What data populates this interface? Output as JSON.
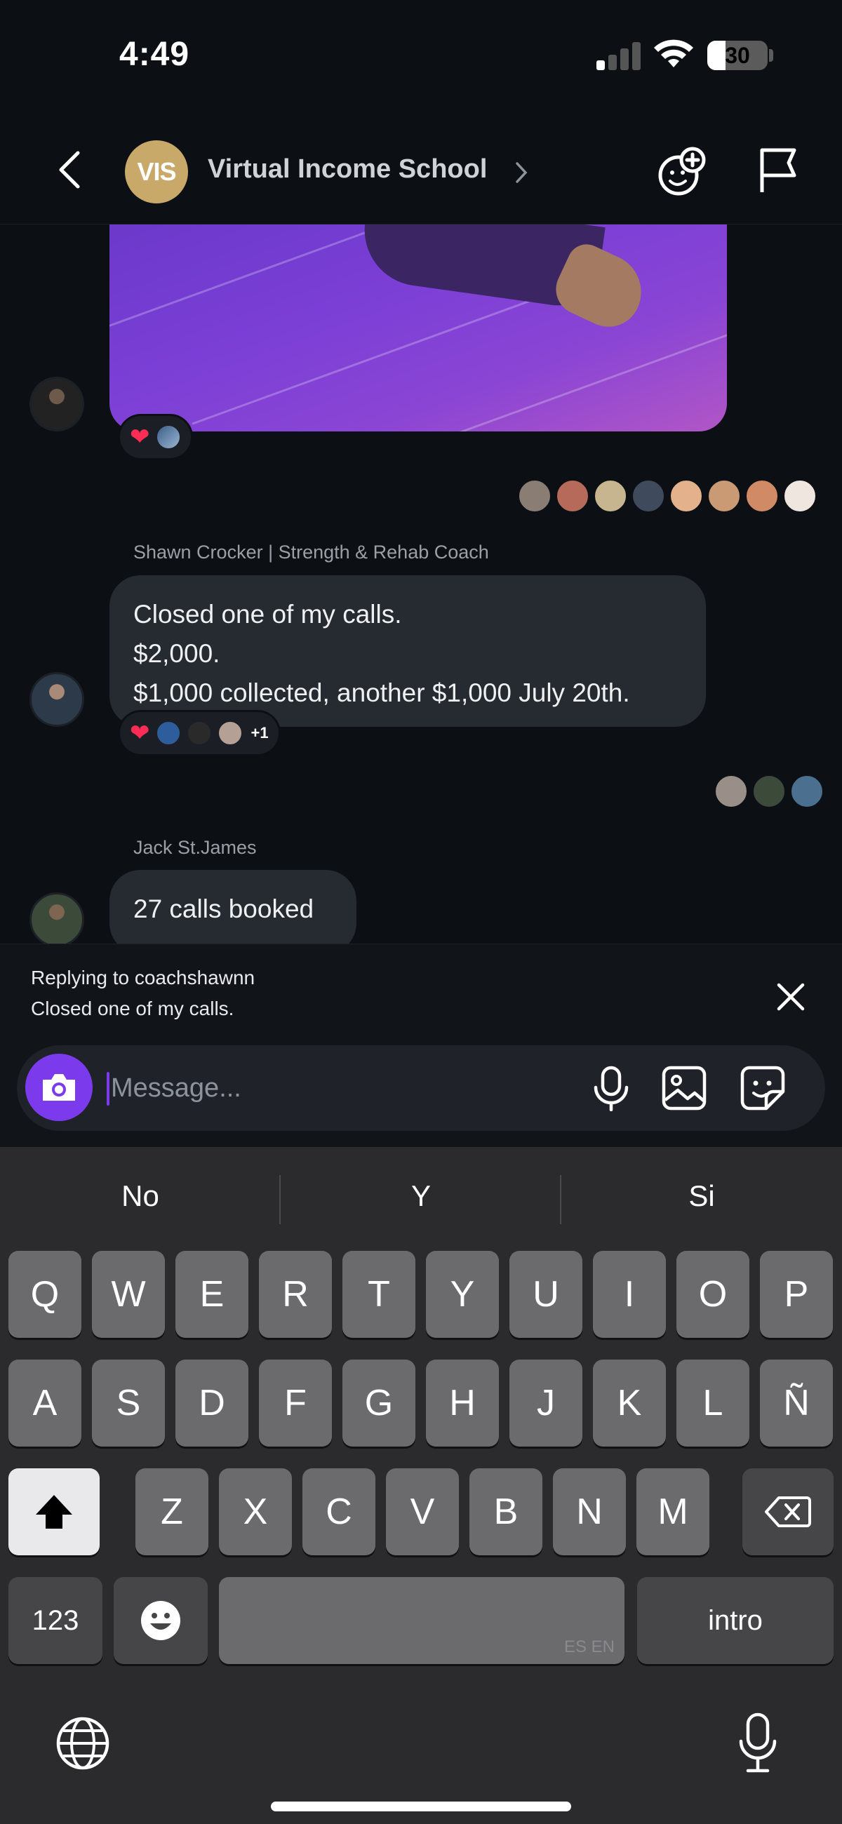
{
  "status_bar": {
    "time": "4:49",
    "battery": "30"
  },
  "header": {
    "group_initials": "VIS",
    "group_name": "Virtual Income School"
  },
  "messages": [
    {
      "sender": "Shawn Crocker | Strength & Rehab Coach",
      "lines": [
        "Closed one of my calls.",
        "$2,000.",
        "$1,000 collected, another $1,000 July 20th."
      ],
      "reaction_extra": "+1"
    },
    {
      "sender": "Jack St.James",
      "lines": [
        "27 calls booked"
      ]
    }
  ],
  "reply": {
    "label": "Replying to coachshawnn",
    "message": "Closed one of my calls."
  },
  "composer": {
    "placeholder": "Message..."
  },
  "keyboard": {
    "suggestions": [
      "No",
      "Y",
      "Si"
    ],
    "row1": [
      "Q",
      "W",
      "E",
      "R",
      "T",
      "Y",
      "U",
      "I",
      "O",
      "P"
    ],
    "row2": [
      "A",
      "S",
      "D",
      "F",
      "G",
      "H",
      "J",
      "K",
      "L",
      "Ñ"
    ],
    "row3": [
      "Z",
      "X",
      "C",
      "V",
      "B",
      "N",
      "M"
    ],
    "numbers_key": "123",
    "return_key": "intro",
    "space_lang": "ES EN"
  },
  "colors": {
    "accent": "#7c3aed",
    "heart": "#ff2d55",
    "vis_gold": "#c9a96a"
  }
}
